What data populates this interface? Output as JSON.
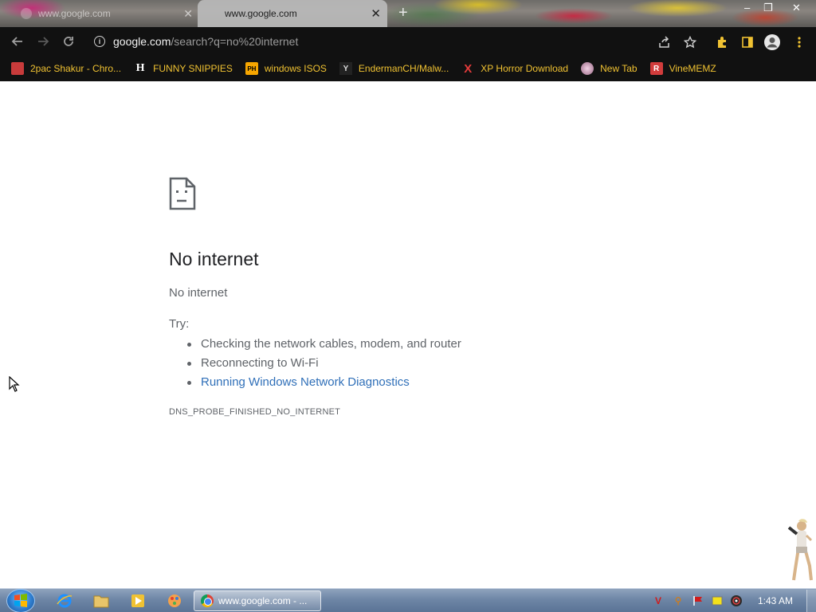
{
  "browser": {
    "tabs": [
      {
        "title": "www.google.com",
        "active": false
      },
      {
        "title": "www.google.com",
        "active": true
      }
    ],
    "new_tab_symbol": "+",
    "window_controls": {
      "minimize": "–",
      "maximize": "❐",
      "close": "✕"
    },
    "address": {
      "host": "google.com",
      "path": "/search?q=no%20internet"
    },
    "nav_icons": [
      "back-arrow-icon",
      "forward-arrow-icon",
      "reload-icon"
    ],
    "toolbar_icons": [
      "share-icon",
      "star-icon",
      "extensions-icon",
      "sidebar-icon",
      "profile-icon",
      "menu-icon"
    ]
  },
  "bookmarks": [
    {
      "label": "2pac Shakur - Chro...",
      "icon": "2pac-favicon",
      "icon_text": "",
      "color": "#c83b3b"
    },
    {
      "label": "FUNNY SNIPPIES",
      "icon": "h-favicon",
      "icon_text": "H",
      "color": "#ffffff"
    },
    {
      "label": "windows ISOS",
      "icon": "ph-favicon",
      "icon_text": "PH",
      "color": "#f7a600"
    },
    {
      "label": "EndermanCH/Malw...",
      "icon": "yp-favicon",
      "icon_text": "Y",
      "color": "#cfcfcf"
    },
    {
      "label": "XP Horror Download",
      "icon": "x-favicon",
      "icon_text": "X",
      "color": "#e43b3b"
    },
    {
      "label": "New Tab",
      "icon": "globe-favicon",
      "icon_text": "",
      "color": "#d4a2c4"
    },
    {
      "label": "VineMEMZ",
      "icon": "r-favicon",
      "icon_text": "R",
      "color": "#d23c3c"
    }
  ],
  "error_page": {
    "title": "No internet",
    "subtitle": "No internet",
    "try_label": "Try:",
    "suggestions": [
      {
        "text": "Checking the network cables, modem, and router",
        "link": false
      },
      {
        "text": "Reconnecting to Wi-Fi",
        "link": false
      },
      {
        "text": "Running Windows Network Diagnostics",
        "link": true
      }
    ],
    "error_code": "DNS_PROBE_FINISHED_NO_INTERNET"
  },
  "taskbar": {
    "pinned": [
      "internet-explorer-icon",
      "file-explorer-icon",
      "media-player-icon",
      "paint-icon"
    ],
    "active_task": "www.google.com - ...",
    "tray_icons": [
      "v-tray-icon",
      "search-tray-icon",
      "flag-tray-icon",
      "battery-tray-icon",
      "volume-tray-icon"
    ],
    "clock": "1:43 AM"
  }
}
